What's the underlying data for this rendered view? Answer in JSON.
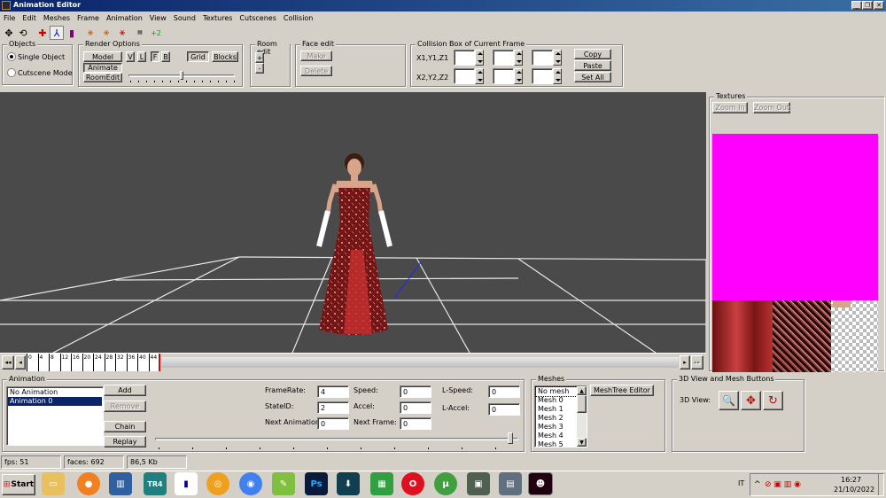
{
  "window": {
    "title": "Animation Editor"
  },
  "menu": [
    "File",
    "Edit",
    "Meshes",
    "Frame",
    "Animation",
    "View",
    "Sound",
    "Textures",
    "Cutscenes",
    "Collision"
  ],
  "objects": {
    "label": "Objects",
    "single": "Single Object",
    "cutscene": "Cutscene Mode"
  },
  "render": {
    "label": "Render Options",
    "model": "Model",
    "v": "V",
    "l": "L",
    "f": "F",
    "b": "B",
    "grid": "Grid",
    "blocks": "Blocks",
    "animate": "Animate",
    "roomedit": "RoomEdit"
  },
  "room": {
    "label": "Room edit",
    "plus": "+",
    "minus": "-"
  },
  "face": {
    "label": "Face edit",
    "make": "Make",
    "delete": "Delete"
  },
  "collision": {
    "label": "Collision Box of Current Frame",
    "row1": "X1,Y1,Z1",
    "row2": "X2,Y2,Z2",
    "copy": "Copy",
    "paste": "Paste",
    "setall": "Set All"
  },
  "textures": {
    "label": "Textures",
    "zoomin": "Zoom In",
    "zoomout": "Zoom Out"
  },
  "timeline": {
    "ticks": [
      "0",
      "4",
      "8",
      "12",
      "16",
      "20",
      "24",
      "28",
      "32",
      "36",
      "40",
      "44"
    ]
  },
  "animation": {
    "label": "Animation",
    "items": [
      "No Animation",
      "Animation 0"
    ],
    "selected": 1,
    "add": "Add",
    "remove": "Remove",
    "chain": "Chain",
    "replay": "Replay",
    "framerate_label": "FrameRate:",
    "framerate": "4",
    "stateid_label": "StateID:",
    "stateid": "2",
    "nextanim_label": "Next Animation:",
    "nextanim": "0",
    "speed_label": "Speed:",
    "speed": "0",
    "accel_label": "Accel:",
    "accel": "0",
    "nextframe_label": "Next Frame:",
    "nextframe": "0",
    "lspeed_label": "L-Speed:",
    "lspeed": "0",
    "laccel_label": "L-Accel:",
    "laccel": "0"
  },
  "meshes": {
    "label": "Meshes",
    "items": [
      "No mesh",
      "Mesh 0",
      "Mesh 1",
      "Mesh 2",
      "Mesh 3",
      "Mesh 4",
      "Mesh 5"
    ],
    "treeeditor": "MeshTree Editor"
  },
  "view3d": {
    "label": "3D View and Mesh Buttons",
    "view_label": "3D View:"
  },
  "status": {
    "fps": "fps: 51",
    "faces": "faces: 692",
    "size": "86,5 Kb"
  },
  "taskbar": {
    "start": "Start",
    "lang": "IT",
    "time": "16:27",
    "date": "21/10/2022",
    "ps": "Ps",
    "tr": "TR4"
  },
  "colors": {
    "viewport": "#4a4a4a",
    "texture_magenta": "#ff00ff",
    "titlebar": "#0a246a",
    "dress": "#8b1a1a"
  }
}
